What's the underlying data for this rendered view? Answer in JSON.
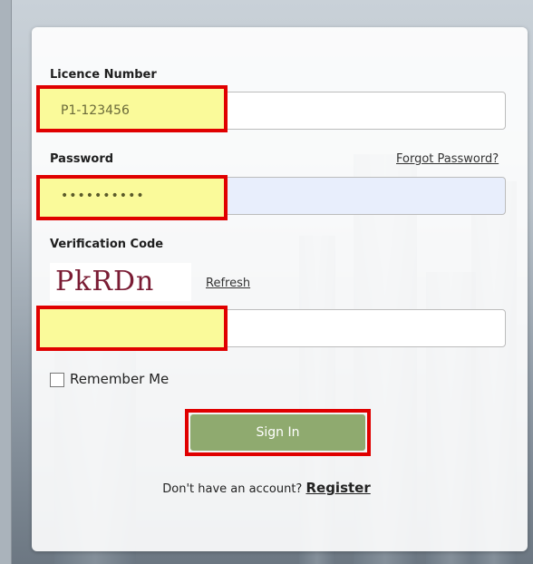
{
  "form": {
    "licence": {
      "label": "Licence Number",
      "value": "P1-123456"
    },
    "password": {
      "label": "Password",
      "value": "••••••••••",
      "forgot": "Forgot Password?"
    },
    "verification": {
      "label": "Verification Code",
      "captcha": "PkRDn",
      "refresh": "Refresh",
      "value": ""
    },
    "remember": {
      "label": "Remember Me",
      "checked": false
    },
    "submit": "Sign In",
    "register": {
      "prompt": "Don't have an account?",
      "link": "Register"
    }
  },
  "colors": {
    "highlight_border": "#e00000",
    "highlight_fill": "#fafa9a",
    "button": "#8faa6f",
    "password_bg": "#e8eefc"
  }
}
